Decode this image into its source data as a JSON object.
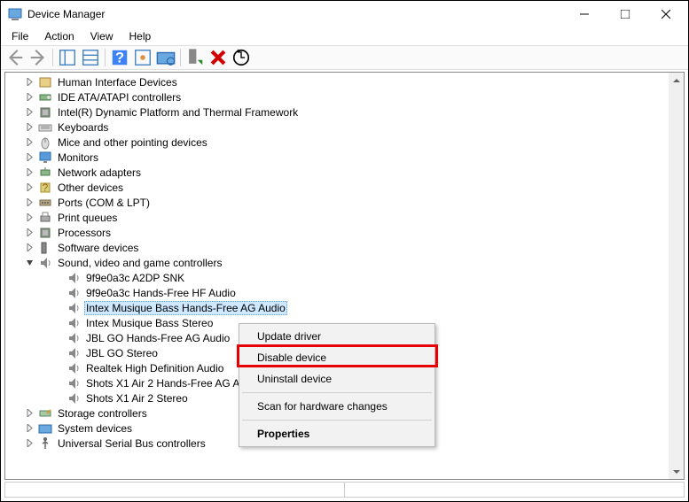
{
  "window": {
    "title": "Device Manager"
  },
  "menu": {
    "file": "File",
    "action": "Action",
    "view": "View",
    "help": "Help"
  },
  "tree": {
    "items": [
      {
        "label": "Human Interface Devices",
        "icon": "hid"
      },
      {
        "label": "IDE ATA/ATAPI controllers",
        "icon": "ide"
      },
      {
        "label": "Intel(R) Dynamic Platform and Thermal Framework",
        "icon": "cpu"
      },
      {
        "label": "Keyboards",
        "icon": "keyboard"
      },
      {
        "label": "Mice and other pointing devices",
        "icon": "mouse"
      },
      {
        "label": "Monitors",
        "icon": "monitor"
      },
      {
        "label": "Network adapters",
        "icon": "net"
      },
      {
        "label": "Other devices",
        "icon": "other"
      },
      {
        "label": "Ports (COM & LPT)",
        "icon": "port"
      },
      {
        "label": "Print queues",
        "icon": "print"
      },
      {
        "label": "Processors",
        "icon": "cpu"
      },
      {
        "label": "Software devices",
        "icon": "sw"
      },
      {
        "label": "Sound, video and game controllers",
        "icon": "sound",
        "expanded": true
      },
      {
        "label": "Storage controllers",
        "icon": "storage"
      },
      {
        "label": "System devices",
        "icon": "system"
      },
      {
        "label": "Universal Serial Bus controllers",
        "icon": "usb"
      }
    ],
    "sound_children": [
      "9f9e0a3c A2DP SNK",
      "9f9e0a3c Hands-Free HF Audio",
      "Intex Musique Bass Hands-Free AG Audio",
      "Intex Musique Bass Stereo",
      "JBL GO Hands-Free AG Audio",
      "JBL GO Stereo",
      "Realtek High Definition Audio",
      "Shots X1 Air 2 Hands-Free AG Audio",
      "Shots X1 Air 2 Stereo"
    ],
    "selected_index": 2
  },
  "context_menu": {
    "update": "Update driver",
    "disable": "Disable device",
    "uninstall": "Uninstall device",
    "scan": "Scan for hardware changes",
    "properties": "Properties"
  }
}
